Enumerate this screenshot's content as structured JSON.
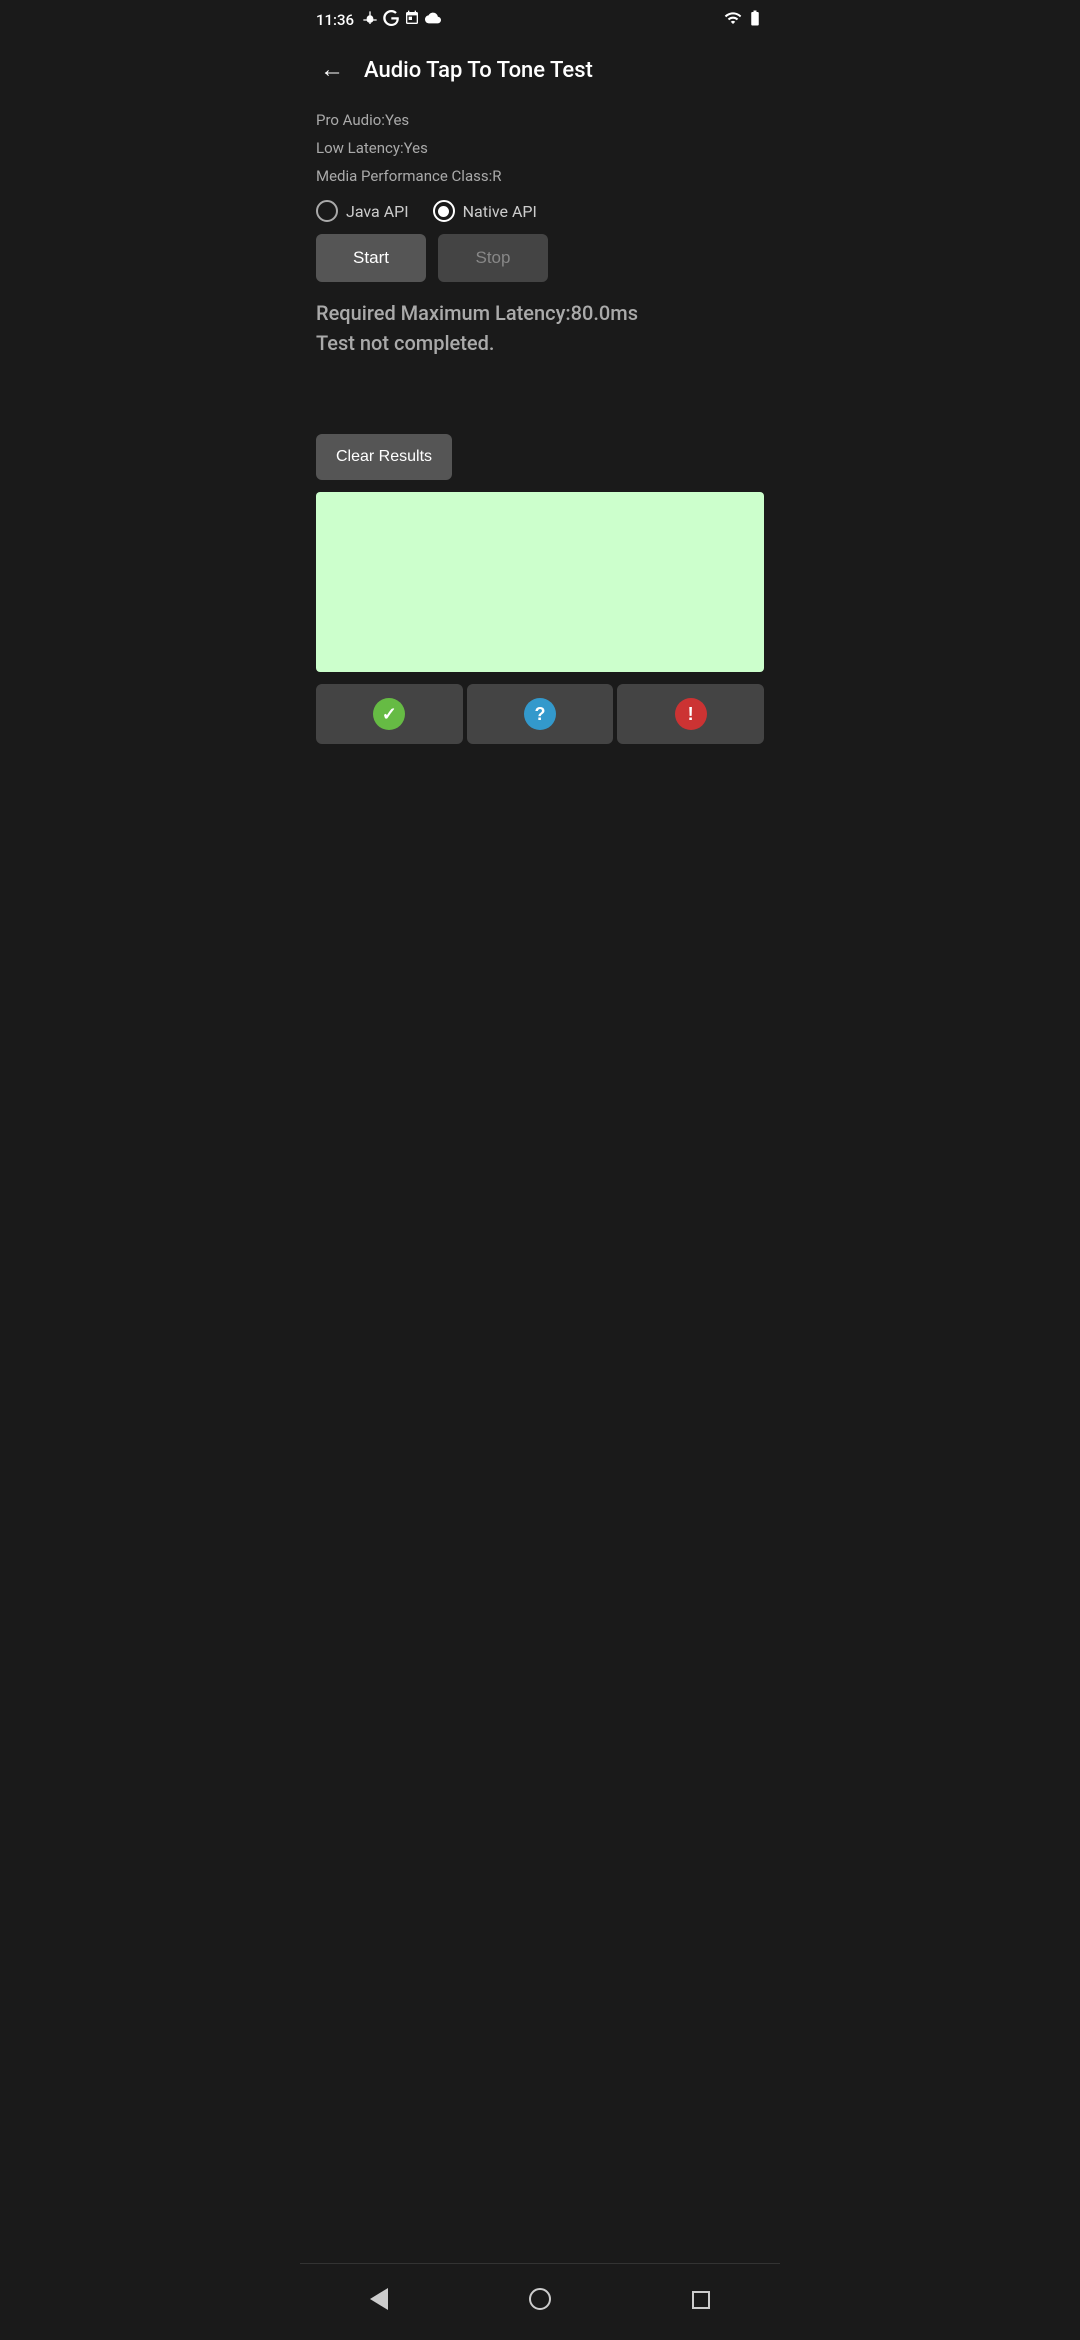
{
  "statusBar": {
    "time": "11:36",
    "icons": [
      "fan",
      "google",
      "calendar",
      "cloud"
    ],
    "wifiLevel": "full",
    "batteryLevel": "high"
  },
  "toolbar": {
    "backLabel": "←",
    "title": "Audio Tap To Tone Test"
  },
  "infoLines": [
    "Pro Audio:Yes",
    "Low Latency:Yes",
    "Media Performance Class:R"
  ],
  "radioGroup": {
    "options": [
      {
        "id": "java",
        "label": "Java API",
        "selected": false
      },
      {
        "id": "native",
        "label": "Native API",
        "selected": true
      }
    ]
  },
  "buttons": {
    "start": "Start",
    "stop": "Stop"
  },
  "resultText": {
    "line1": "Required Maximum Latency:80.0ms",
    "line2": "Test not completed."
  },
  "clearResults": "Clear Results",
  "bottomButtons": {
    "check": "✓",
    "question": "?",
    "exclamation": "!"
  },
  "navBar": {
    "back": "back",
    "home": "home",
    "recent": "recent"
  }
}
